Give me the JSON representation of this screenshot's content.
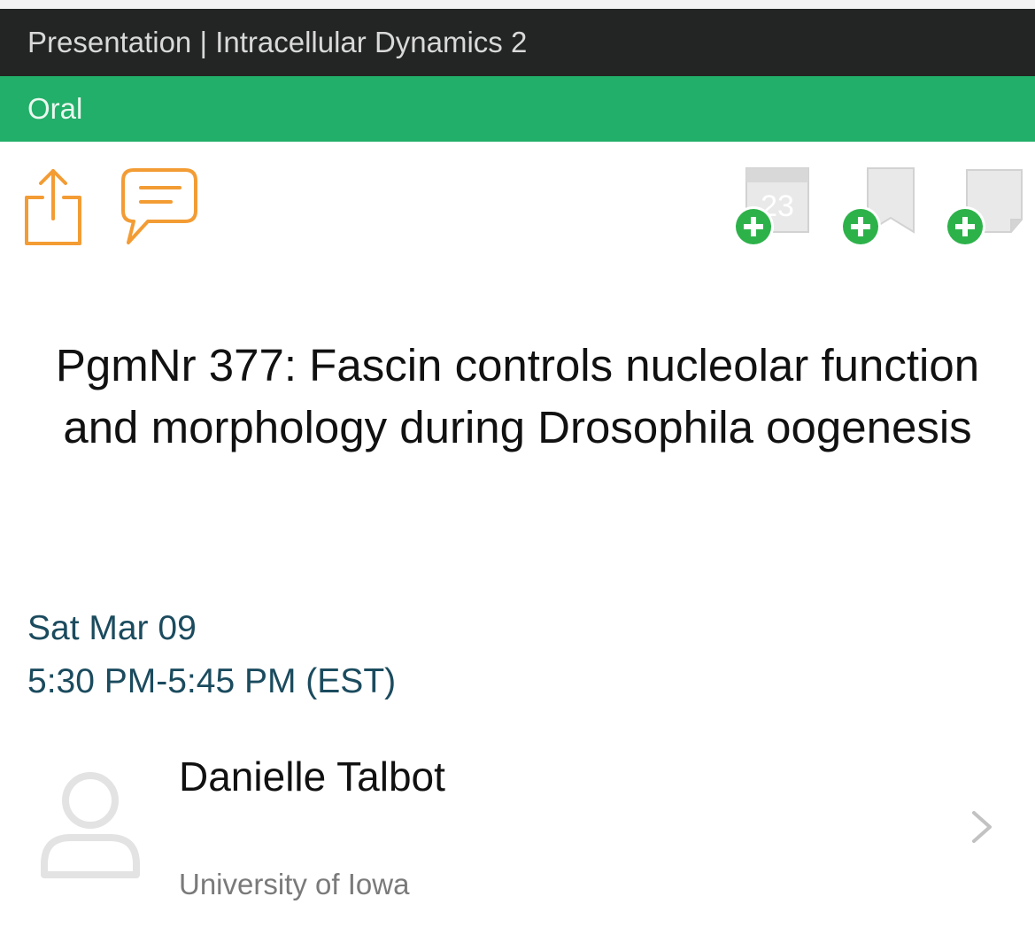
{
  "header": {
    "title": "Presentation | Intracellular Dynamics 2",
    "session_type": "Oral"
  },
  "actions": {
    "share_icon": "share-icon",
    "comment_icon": "comment-icon",
    "calendar_icon": "add-to-calendar-icon",
    "calendar_day": "23",
    "bookmark_icon": "add-bookmark-icon",
    "note_icon": "add-note-icon"
  },
  "presentation": {
    "title": "PgmNr 377: Fascin controls nucleolar function and morphology during Drosophila oogenesis",
    "date": "Sat Mar 09",
    "time": "5:30 PM-5:45 PM (EST)"
  },
  "speaker": {
    "name": "Danielle Talbot",
    "affiliation": "University of Iowa"
  },
  "colors": {
    "header_bg": "#222524",
    "type_bar_bg": "#22af69",
    "accent_orange": "#f39c34",
    "add_green": "#2db24a",
    "date_text": "#1b4b5e"
  }
}
